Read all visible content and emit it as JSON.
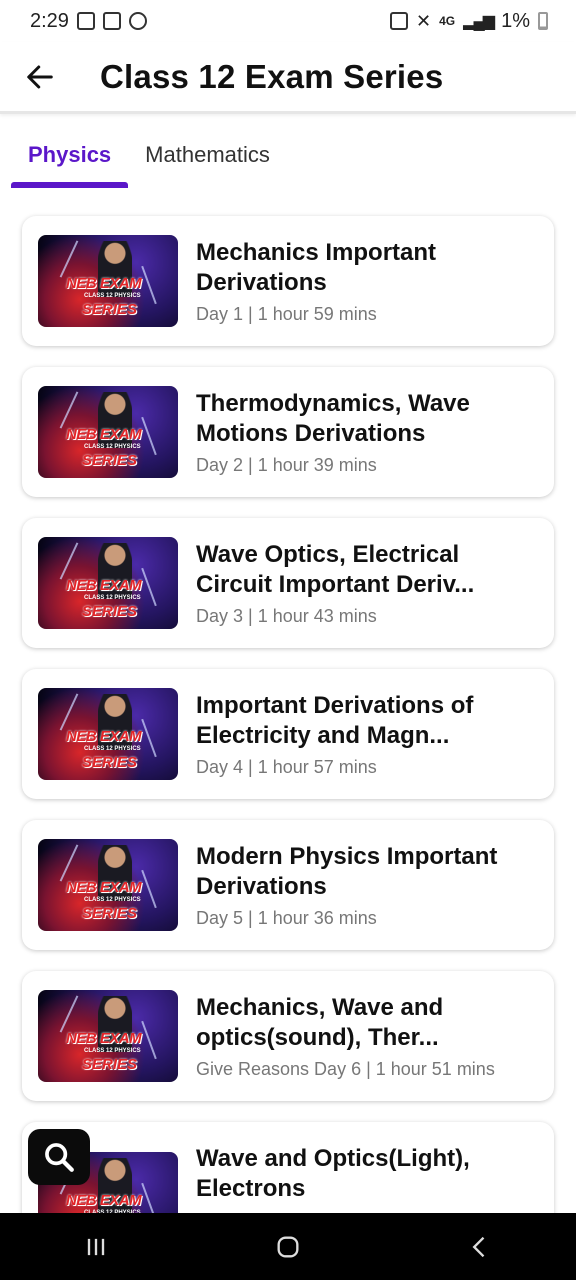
{
  "status_bar": {
    "time": "2:29",
    "network": "4G",
    "battery": "1%"
  },
  "header": {
    "title": "Class 12 Exam Series"
  },
  "tabs": [
    {
      "label": "Physics",
      "active": true
    },
    {
      "label": "Mathematics",
      "active": false
    }
  ],
  "thumbnail": {
    "line1": "NEB EXAM",
    "line2": "CLASS 12 PHYSICS",
    "line3": "SERIES"
  },
  "videos": [
    {
      "title": "Mechanics Important Derivations",
      "meta": "Day 1 | 1 hour 59 mins"
    },
    {
      "title": "Thermodynamics, Wave Motions Derivations",
      "meta": "Day 2 | 1 hour 39 mins"
    },
    {
      "title": "Wave Optics, Electrical Circuit Important Deriv...",
      "meta": "Day 3 | 1 hour 43 mins"
    },
    {
      "title": "Important Derivations of Electricity and Magn...",
      "meta": "Day 4 | 1 hour 57 mins"
    },
    {
      "title": "Modern Physics Important Derivations",
      "meta": "Day 5 | 1 hour 36 mins"
    },
    {
      "title": "Mechanics, Wave and optics(sound), Ther...",
      "meta": "Give Reasons Day 6 | 1 hour 51 mins"
    },
    {
      "title": "Wave and Optics(Light), Electrons",
      "meta": ""
    }
  ],
  "icons": {
    "back": "arrow-back-icon",
    "search": "search-icon",
    "recents": "recents-icon",
    "home": "home-icon",
    "nav_back": "nav-back-icon"
  },
  "colors": {
    "accent": "#5b17c9",
    "thumbnail_text": "#e22428"
  }
}
